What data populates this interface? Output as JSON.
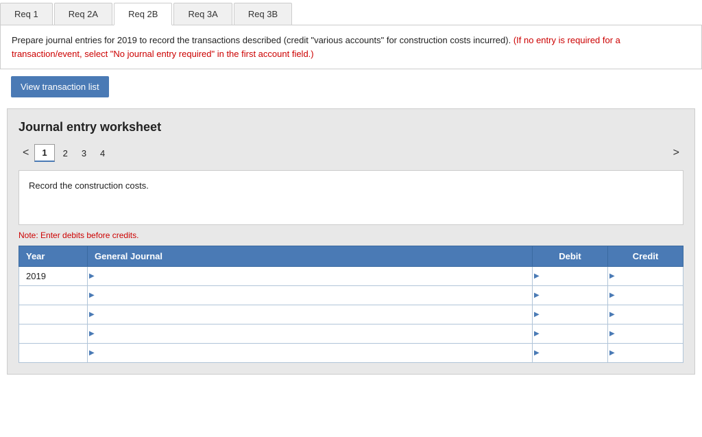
{
  "tabs": [
    {
      "id": "req1",
      "label": "Req 1",
      "active": false
    },
    {
      "id": "req2a",
      "label": "Req 2A",
      "active": false
    },
    {
      "id": "req2b",
      "label": "Req 2B",
      "active": true
    },
    {
      "id": "req3a",
      "label": "Req 3A",
      "active": false
    },
    {
      "id": "req3b",
      "label": "Req 3B",
      "active": false
    }
  ],
  "instructions": {
    "main": "Prepare journal entries for 2019 to record the transactions described (credit \"various accounts\" for construction costs incurred).",
    "red": "(If no entry is required for a transaction/event, select \"No journal entry required\" in the first account field.)"
  },
  "view_transaction_button": "View transaction list",
  "worksheet": {
    "title": "Journal entry worksheet",
    "pages": [
      "1",
      "2",
      "3",
      "4"
    ],
    "current_page": "1",
    "description": "Record the construction costs.",
    "note": "Note: Enter debits before credits.",
    "table": {
      "headers": {
        "year": "Year",
        "general_journal": "General Journal",
        "debit": "Debit",
        "credit": "Credit"
      },
      "rows": [
        {
          "year": "2019",
          "gj": "",
          "debit": "",
          "credit": ""
        },
        {
          "year": "",
          "gj": "",
          "debit": "",
          "credit": ""
        },
        {
          "year": "",
          "gj": "",
          "debit": "",
          "credit": ""
        },
        {
          "year": "",
          "gj": "",
          "debit": "",
          "credit": ""
        },
        {
          "year": "",
          "gj": "",
          "debit": "",
          "credit": ""
        }
      ]
    }
  },
  "chevron_left": "<",
  "chevron_right": ">"
}
